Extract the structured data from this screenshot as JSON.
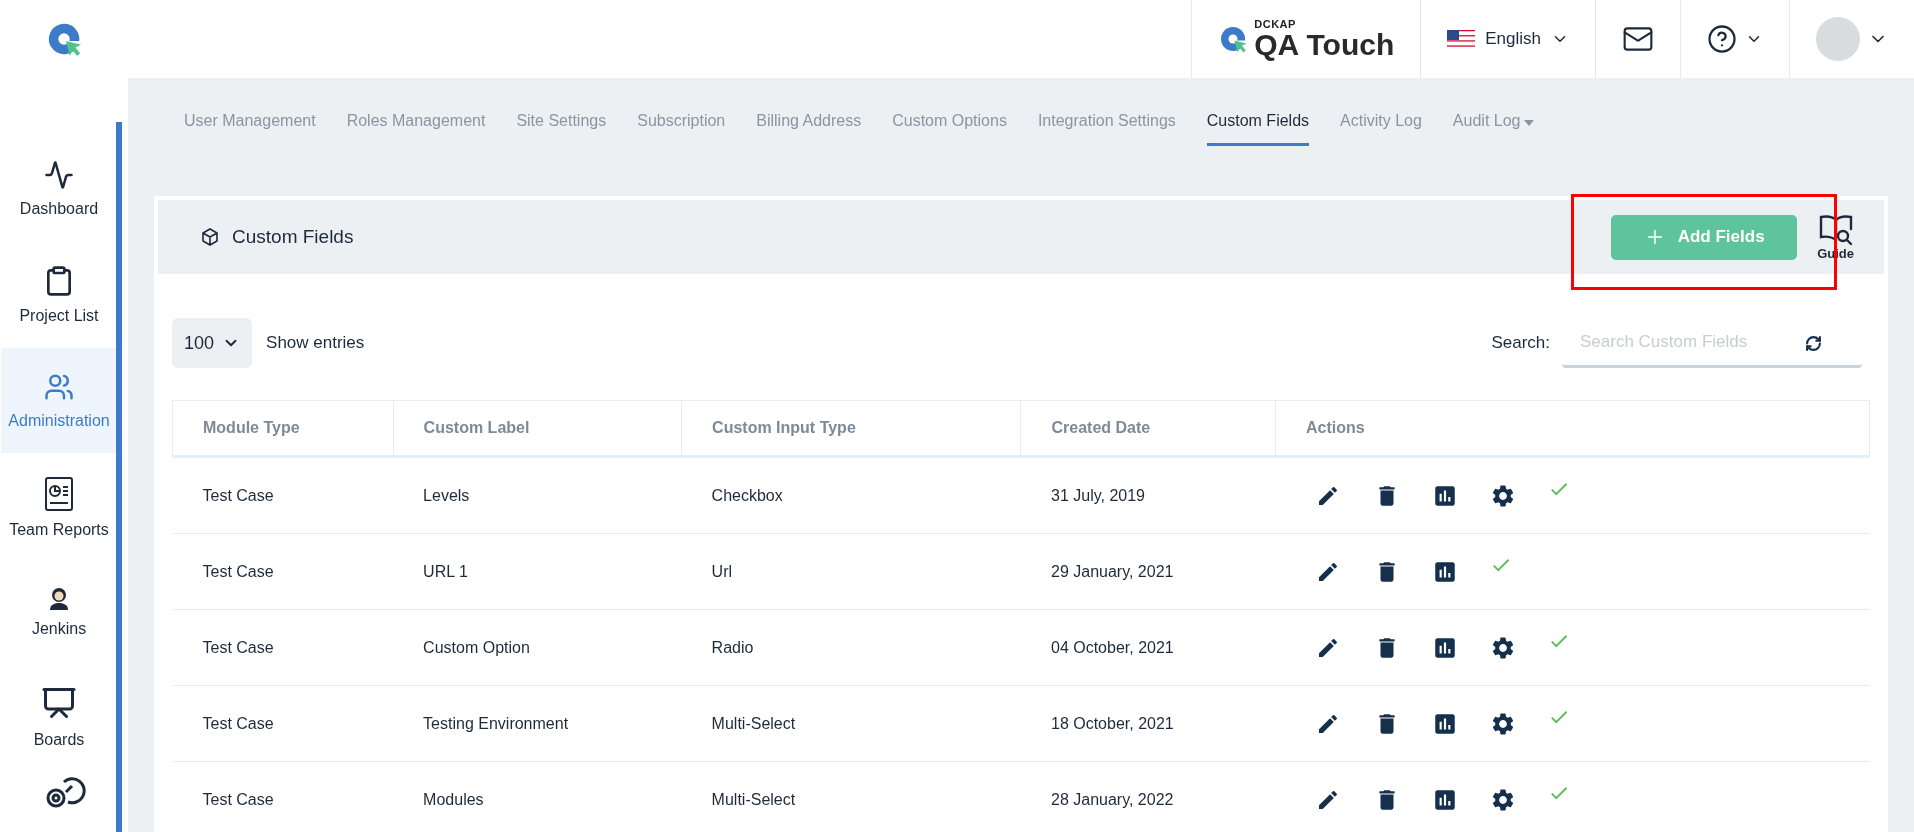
{
  "brand": {
    "company": "DCKAP",
    "product": "QA Touch"
  },
  "header": {
    "language": "English"
  },
  "sidebar": {
    "items": [
      {
        "label": "Dashboard",
        "selected": false
      },
      {
        "label": "Project List",
        "selected": false
      },
      {
        "label": "Administration",
        "selected": true
      },
      {
        "label": "Team Reports",
        "selected": false
      },
      {
        "label": "Jenkins",
        "selected": false
      },
      {
        "label": "Boards",
        "selected": false
      }
    ]
  },
  "tabs": [
    {
      "label": "User Management",
      "selected": false
    },
    {
      "label": "Roles Management",
      "selected": false
    },
    {
      "label": "Site Settings",
      "selected": false
    },
    {
      "label": "Subscription",
      "selected": false
    },
    {
      "label": "Billing Address",
      "selected": false
    },
    {
      "label": "Custom Options",
      "selected": false
    },
    {
      "label": "Integration Settings",
      "selected": false
    },
    {
      "label": "Custom Fields",
      "selected": true
    },
    {
      "label": "Activity Log",
      "selected": false
    },
    {
      "label": "Audit Log",
      "selected": false,
      "dropdown": true
    }
  ],
  "panel": {
    "title": "Custom Fields",
    "add_button": "Add Fields",
    "guide": "Guide",
    "highlight_add_button": true
  },
  "entries": {
    "value": "100",
    "label": "Show entries"
  },
  "search": {
    "label": "Search:",
    "placeholder": "Search Custom Fields"
  },
  "table": {
    "columns": [
      "Module Type",
      "Custom Label",
      "Custom Input Type",
      "Created Date",
      "Actions"
    ],
    "rows": [
      {
        "cells": [
          "Test Case",
          "Levels",
          "Checkbox",
          "31 July, 2019"
        ],
        "settings": true,
        "active": true
      },
      {
        "cells": [
          "Test Case",
          "URL 1",
          "Url",
          "29 January, 2021"
        ],
        "settings": false,
        "active": true
      },
      {
        "cells": [
          "Test Case",
          "Custom Option",
          "Radio",
          "04 October, 2021"
        ],
        "settings": true,
        "active": true
      },
      {
        "cells": [
          "Test Case",
          "Testing Environment",
          "Multi-Select",
          "18 October, 2021"
        ],
        "settings": true,
        "active": true
      },
      {
        "cells": [
          "Test Case",
          "Modules",
          "Multi-Select",
          "28 January, 2022"
        ],
        "settings": true,
        "active": true
      }
    ]
  }
}
